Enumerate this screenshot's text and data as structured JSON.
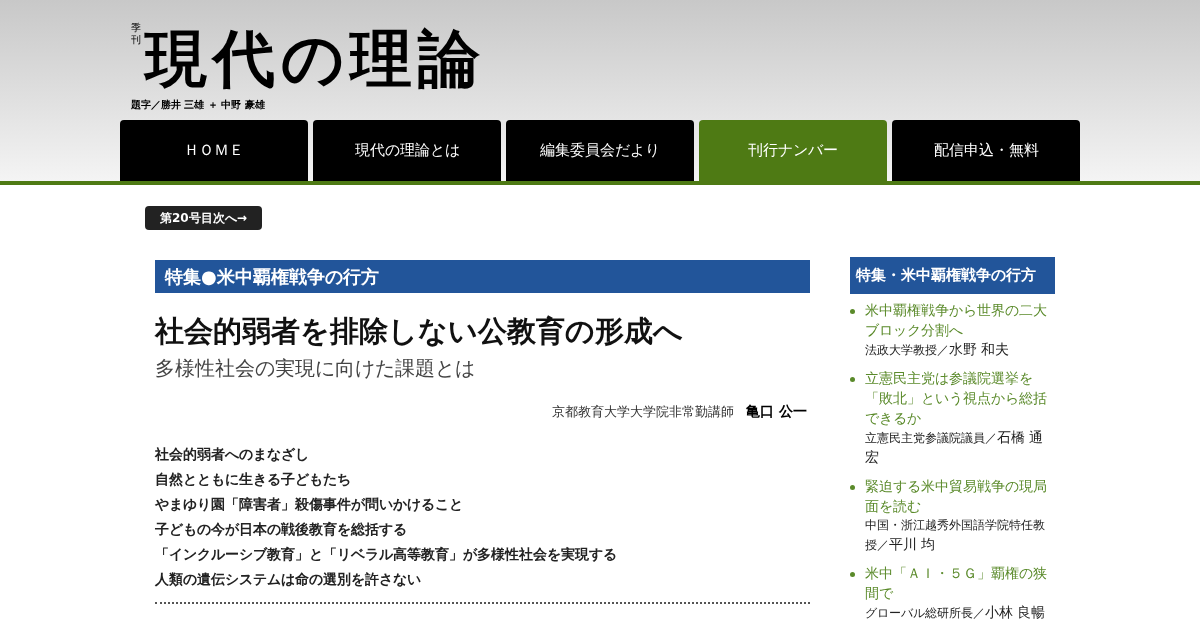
{
  "header": {
    "logo": {
      "prefix": "季刊",
      "title": "現代の理論",
      "credit": "題字／勝井 三雄 ＋ 中野 豪雄"
    }
  },
  "nav": [
    {
      "label": "ＨＯＭＥ",
      "selected": false
    },
    {
      "label": "現代の理論とは",
      "selected": false
    },
    {
      "label": "編集委員会だより",
      "selected": false
    },
    {
      "label": "刊行ナンバー",
      "selected": true
    },
    {
      "label": "配信申込・無料",
      "selected": false
    }
  ],
  "back_link": "第20号目次へ→",
  "article": {
    "section": "特集●米中覇権戦争の行方",
    "title": "社会的弱者を排除しない公教育の形成へ",
    "subtitle": "多様性社会の実現に向けた課題とは",
    "author": {
      "affiliation": "京都教育大学大学院非常勤講師",
      "name": "亀口 公一"
    },
    "contents": [
      "社会的弱者へのまなざし",
      "自然とともに生きる子どもたち",
      "やまゆり園「障害者」殺傷事件が問いかけること",
      "子どもの今が日本の戦後教育を総括する",
      "「インクルーシブ教育」と「リベラル高等教育」が多様性社会を実現する",
      "人類の遺伝システムは命の選別を許さない"
    ]
  },
  "sidebar": {
    "heading": "特集・米中覇権戦争の行方",
    "items": [
      {
        "title": "米中覇権戦争から世界の二大ブロック分割へ",
        "affiliation": "法政大学教授／",
        "name": "水野 和夫"
      },
      {
        "title": "立憲民主党は参議院選挙を「敗北」という視点から総括できるか",
        "affiliation": "立憲民主党参議院議員／",
        "name": "石橋 通宏"
      },
      {
        "title": "緊迫する米中貿易戦争の現局面を読む",
        "affiliation": "中国・浙江越秀外国語学院特任教授／",
        "name": "平川 均"
      },
      {
        "title": "米中「ＡＩ・５Ｇ」覇権の狭間で",
        "affiliation": "グローバル総研所長／",
        "name": "小林 良暢"
      }
    ]
  }
}
